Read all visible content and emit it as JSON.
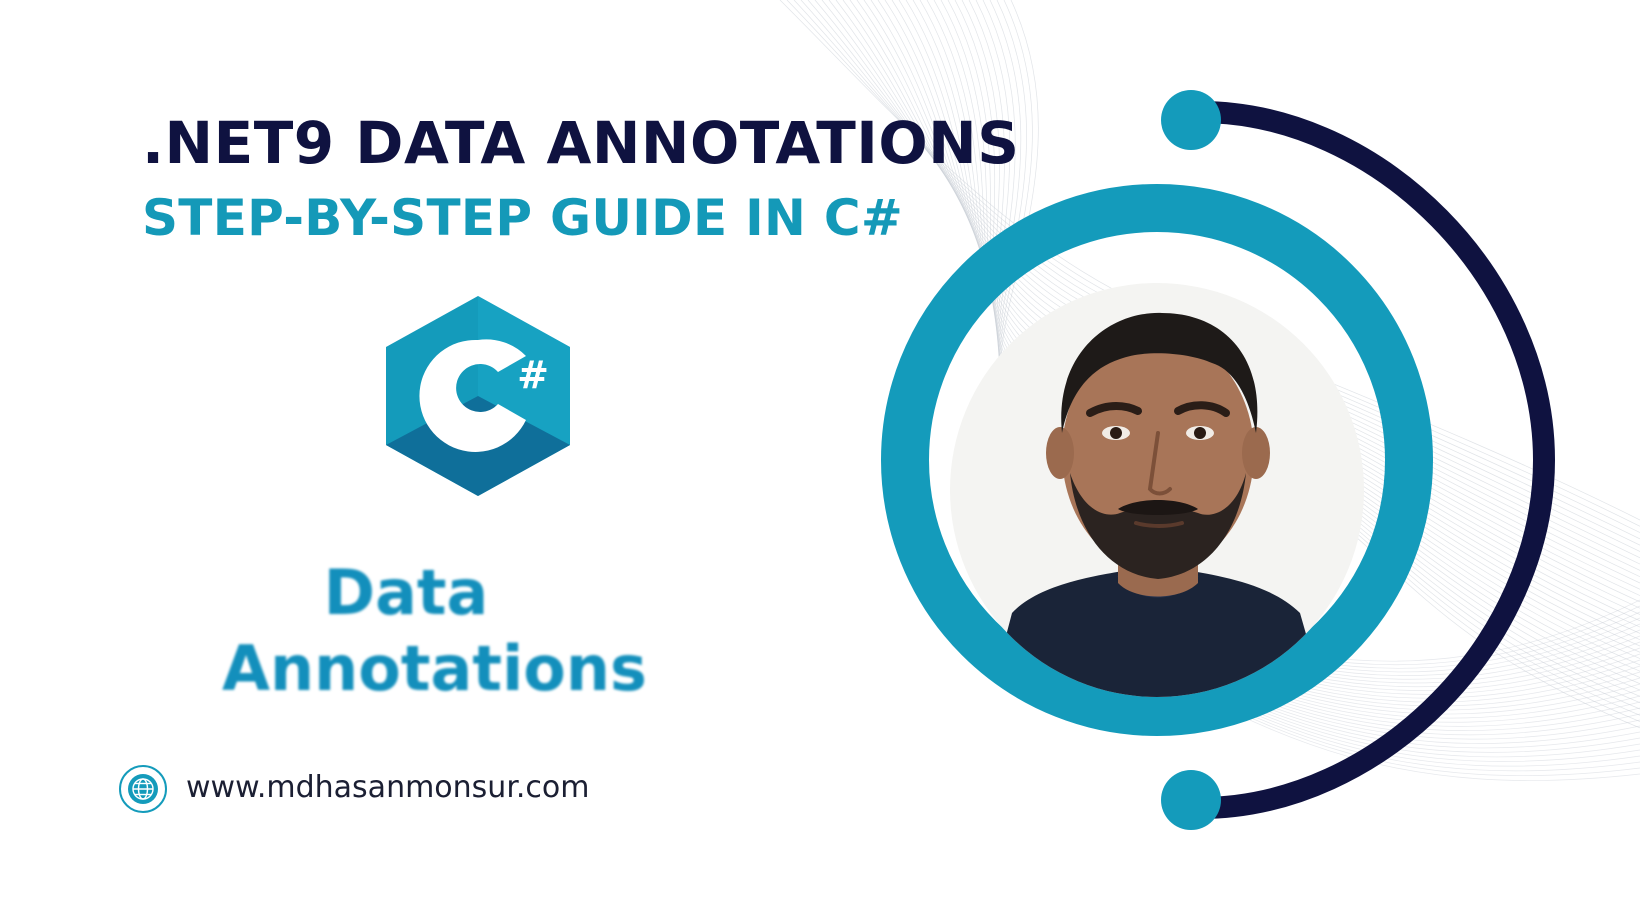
{
  "headline": {
    "title": ".NET9 DATA ANNOTATIONS",
    "subtitle": "STEP-BY-STEP GUIDE IN C#"
  },
  "logo": {
    "mark_text": "C#",
    "line1": "Data",
    "line2": "Annotations"
  },
  "footer": {
    "icon": "globe-icon",
    "url": "www.mdhasanmonsur.com"
  },
  "portrait": {
    "icon": "person-portrait"
  },
  "colors": {
    "navy": "#0f1240",
    "teal": "#149bbb",
    "logo_blue": "#138fbc",
    "logo_dark": "#0f6f9a",
    "text_dark": "#1b1f33"
  }
}
